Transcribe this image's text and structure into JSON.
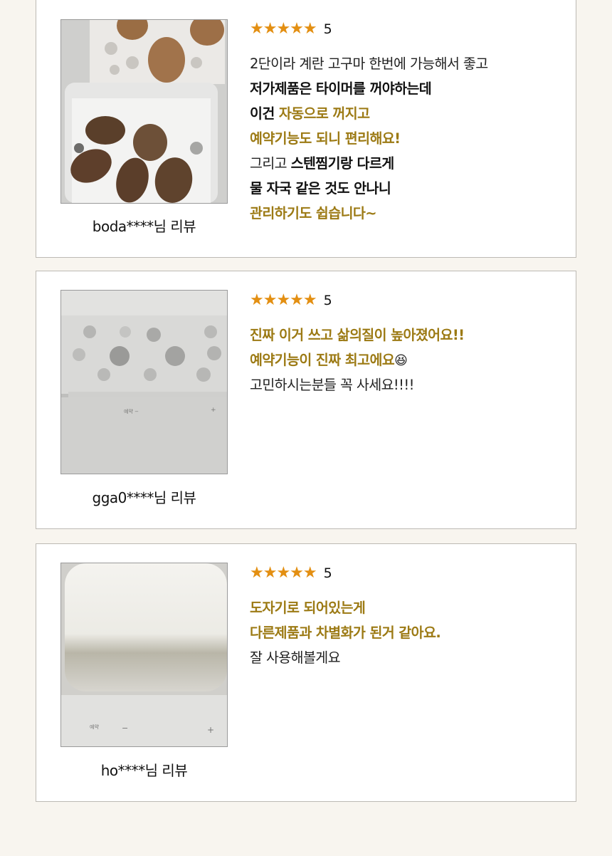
{
  "colors": {
    "background": "#f8f5ef",
    "card": "#ffffff",
    "border": "#bdbab4",
    "star": "#e38f12",
    "highlight": "#9c7a14",
    "text": "#222222"
  },
  "reviews": [
    {
      "stars": "★★★★★",
      "score": "5",
      "author": "boda****님 리뷰",
      "photo_icon": "eggs-and-sweet-potatoes-photo",
      "lines": [
        [
          {
            "text": "2단이라 계란 고구마 한번에 가능해서 좋고",
            "style": "light"
          }
        ],
        [
          {
            "text": "저가제품은 타이머를 꺼야하는데",
            "style": "dark"
          }
        ],
        [
          {
            "text": "이건 ",
            "style": "dark"
          },
          {
            "text": "자동으로 꺼지고",
            "style": "gold"
          }
        ],
        [
          {
            "text": "예약기능도 되니 편리해요!",
            "style": "gold"
          }
        ],
        [
          {
            "text": "그리고 ",
            "style": "light"
          },
          {
            "text": "스텐찜기랑 다르게",
            "style": "dark"
          }
        ],
        [
          {
            "text": "물 자국 같은 것도 안나니",
            "style": "dark"
          }
        ],
        [
          {
            "text": "관리하기도 쉽습니다~",
            "style": "gold"
          }
        ]
      ]
    },
    {
      "stars": "★★★★★",
      "score": "5",
      "author": "gga0****님 리뷰",
      "photo_icon": "steamer-closeup-photo",
      "lines": [
        [
          {
            "text": "진짜 이거 쓰고 삶의질이 높아졌어요!!",
            "style": "gold"
          }
        ],
        [
          {
            "text": "예약기능이 진짜 최고에요",
            "style": "gold"
          },
          {
            "text": "😆",
            "style": "emoji"
          }
        ],
        [
          {
            "text": "고민하시는분들 꼭 사세요!!!!",
            "style": "light"
          }
        ]
      ]
    },
    {
      "stars": "★★★★★",
      "score": "5",
      "author": "ho****님 리뷰",
      "photo_icon": "ceramic-lid-photo",
      "lines": [
        [
          {
            "text": "도자기로 되어있는게",
            "style": "gold"
          }
        ],
        [
          {
            "text": "다른제품과 차별화가 된거 같아요.",
            "style": "gold"
          }
        ],
        [
          {
            "text": "잘 사용해볼게요",
            "style": "light"
          }
        ]
      ]
    }
  ]
}
